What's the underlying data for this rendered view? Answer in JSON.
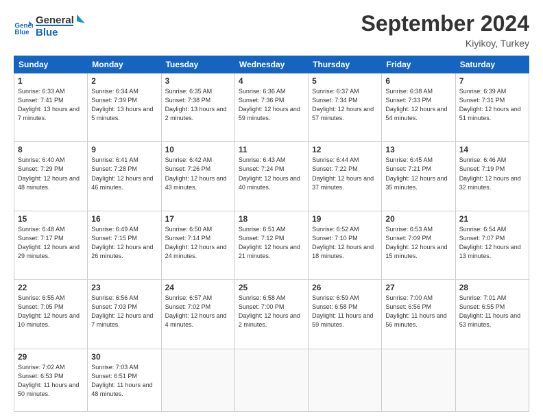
{
  "header": {
    "logo_line1": "General",
    "logo_line2": "Blue",
    "month": "September 2024",
    "location": "Kiyikoy, Turkey"
  },
  "weekdays": [
    "Sunday",
    "Monday",
    "Tuesday",
    "Wednesday",
    "Thursday",
    "Friday",
    "Saturday"
  ],
  "weeks": [
    [
      {
        "day": "1",
        "info": "Sunrise: 6:33 AM\nSunset: 7:41 PM\nDaylight: 13 hours and 7 minutes."
      },
      {
        "day": "2",
        "info": "Sunrise: 6:34 AM\nSunset: 7:39 PM\nDaylight: 13 hours and 5 minutes."
      },
      {
        "day": "3",
        "info": "Sunrise: 6:35 AM\nSunset: 7:38 PM\nDaylight: 13 hours and 2 minutes."
      },
      {
        "day": "4",
        "info": "Sunrise: 6:36 AM\nSunset: 7:36 PM\nDaylight: 12 hours and 59 minutes."
      },
      {
        "day": "5",
        "info": "Sunrise: 6:37 AM\nSunset: 7:34 PM\nDaylight: 12 hours and 57 minutes."
      },
      {
        "day": "6",
        "info": "Sunrise: 6:38 AM\nSunset: 7:33 PM\nDaylight: 12 hours and 54 minutes."
      },
      {
        "day": "7",
        "info": "Sunrise: 6:39 AM\nSunset: 7:31 PM\nDaylight: 12 hours and 51 minutes."
      }
    ],
    [
      {
        "day": "8",
        "info": "Sunrise: 6:40 AM\nSunset: 7:29 PM\nDaylight: 12 hours and 48 minutes."
      },
      {
        "day": "9",
        "info": "Sunrise: 6:41 AM\nSunset: 7:28 PM\nDaylight: 12 hours and 46 minutes."
      },
      {
        "day": "10",
        "info": "Sunrise: 6:42 AM\nSunset: 7:26 PM\nDaylight: 12 hours and 43 minutes."
      },
      {
        "day": "11",
        "info": "Sunrise: 6:43 AM\nSunset: 7:24 PM\nDaylight: 12 hours and 40 minutes."
      },
      {
        "day": "12",
        "info": "Sunrise: 6:44 AM\nSunset: 7:22 PM\nDaylight: 12 hours and 37 minutes."
      },
      {
        "day": "13",
        "info": "Sunrise: 6:45 AM\nSunset: 7:21 PM\nDaylight: 12 hours and 35 minutes."
      },
      {
        "day": "14",
        "info": "Sunrise: 6:46 AM\nSunset: 7:19 PM\nDaylight: 12 hours and 32 minutes."
      }
    ],
    [
      {
        "day": "15",
        "info": "Sunrise: 6:48 AM\nSunset: 7:17 PM\nDaylight: 12 hours and 29 minutes."
      },
      {
        "day": "16",
        "info": "Sunrise: 6:49 AM\nSunset: 7:15 PM\nDaylight: 12 hours and 26 minutes."
      },
      {
        "day": "17",
        "info": "Sunrise: 6:50 AM\nSunset: 7:14 PM\nDaylight: 12 hours and 24 minutes."
      },
      {
        "day": "18",
        "info": "Sunrise: 6:51 AM\nSunset: 7:12 PM\nDaylight: 12 hours and 21 minutes."
      },
      {
        "day": "19",
        "info": "Sunrise: 6:52 AM\nSunset: 7:10 PM\nDaylight: 12 hours and 18 minutes."
      },
      {
        "day": "20",
        "info": "Sunrise: 6:53 AM\nSunset: 7:09 PM\nDaylight: 12 hours and 15 minutes."
      },
      {
        "day": "21",
        "info": "Sunrise: 6:54 AM\nSunset: 7:07 PM\nDaylight: 12 hours and 13 minutes."
      }
    ],
    [
      {
        "day": "22",
        "info": "Sunrise: 6:55 AM\nSunset: 7:05 PM\nDaylight: 12 hours and 10 minutes."
      },
      {
        "day": "23",
        "info": "Sunrise: 6:56 AM\nSunset: 7:03 PM\nDaylight: 12 hours and 7 minutes."
      },
      {
        "day": "24",
        "info": "Sunrise: 6:57 AM\nSunset: 7:02 PM\nDaylight: 12 hours and 4 minutes."
      },
      {
        "day": "25",
        "info": "Sunrise: 6:58 AM\nSunset: 7:00 PM\nDaylight: 12 hours and 2 minutes."
      },
      {
        "day": "26",
        "info": "Sunrise: 6:59 AM\nSunset: 6:58 PM\nDaylight: 11 hours and 59 minutes."
      },
      {
        "day": "27",
        "info": "Sunrise: 7:00 AM\nSunset: 6:56 PM\nDaylight: 11 hours and 56 minutes."
      },
      {
        "day": "28",
        "info": "Sunrise: 7:01 AM\nSunset: 6:55 PM\nDaylight: 11 hours and 53 minutes."
      }
    ],
    [
      {
        "day": "29",
        "info": "Sunrise: 7:02 AM\nSunset: 6:53 PM\nDaylight: 11 hours and 50 minutes."
      },
      {
        "day": "30",
        "info": "Sunrise: 7:03 AM\nSunset: 6:51 PM\nDaylight: 11 hours and 48 minutes."
      },
      null,
      null,
      null,
      null,
      null
    ]
  ]
}
